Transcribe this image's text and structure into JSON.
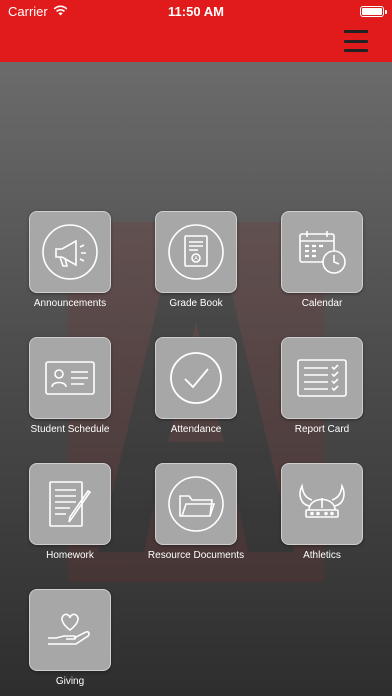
{
  "status_bar": {
    "carrier": "Carrier",
    "time": "11:50 AM"
  },
  "header": {
    "menu_icon": "hamburger-icon",
    "accent_color": "#e11b1b"
  },
  "tiles": [
    {
      "label": "Announcements",
      "icon": "megaphone-icon"
    },
    {
      "label": "Grade Book",
      "icon": "gradebook-icon"
    },
    {
      "label": "Calendar",
      "icon": "calendar-clock-icon"
    },
    {
      "label": "Student Schedule",
      "icon": "id-card-icon"
    },
    {
      "label": "Attendance",
      "icon": "checkmark-circle-icon"
    },
    {
      "label": "Report Card",
      "icon": "checklist-icon"
    },
    {
      "label": "Homework",
      "icon": "document-pencil-icon"
    },
    {
      "label": "Resource Documents",
      "icon": "folder-icon"
    },
    {
      "label": "Athletics",
      "icon": "viking-helmet-icon"
    },
    {
      "label": "Giving",
      "icon": "heart-hand-icon"
    }
  ]
}
